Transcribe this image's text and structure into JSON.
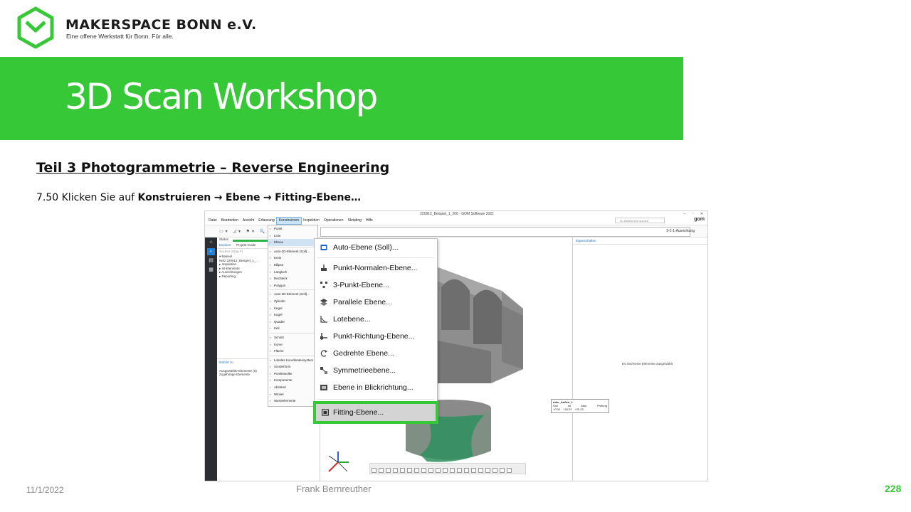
{
  "brand": {
    "name": "MAKERSPACE BONN e.V.",
    "tagline": "Eine offene Werkstatt für Bonn. Für alle.",
    "color": "#37c837"
  },
  "title": "3D Scan Workshop",
  "section_heading": "Teil 3  Photogrammetrie  – Reverse Engineering",
  "instruction": {
    "prefix": "7.50 Klicken Sie auf ",
    "step1": "Konstruieren",
    "step2": "Ebene",
    "step3": "Fitting-Ebene…",
    "arrow": "→"
  },
  "app": {
    "window_title": "220912_Beispiel_1_200 - GOM Software 2021",
    "window_controls": "– ▫ ✕",
    "menu": [
      "Datei",
      "Bearbeiten",
      "Ansicht",
      "Erfassung",
      "Konstruieren",
      "Inspektion",
      "Operationen",
      "Skripting",
      "Hilfe"
    ],
    "active_menu": "Konstruieren",
    "search_placeholder": "Im Zielelement suchen",
    "logo": "gom",
    "alignment": "3-2-1-Ausrichtung",
    "explorer": {
      "status_label": "Status",
      "tabs": [
        "Explorer",
        "Projekt-Guide"
      ],
      "search_placeholder": "Suchen (Strg+F)",
      "tree": [
        "▾ Basisel.",
        "   Netz 220912_Beispiel_1_...",
        " ▸ Inspektion",
        " ▸ Ist-Elemente",
        " ▸ Ausrichtungen",
        "▸ Reporting"
      ],
      "bottom_tab": "Gehört zu",
      "bottom_items": [
        "Ausgewählte Elemente (0)",
        "Zugehörige Elemente"
      ]
    },
    "right_panel": {
      "tab": "Eigenschaften",
      "empty_message": "Es sind keine Elemente ausgewählt."
    },
    "konstruieren_menu": [
      "Punkt",
      "Linie",
      "Ebene",
      "Auto-2D-Element (Soll)...",
      "Kreis",
      "Ellipse",
      "Langloch",
      "Rechteck",
      "Polygon",
      "Auto-3D-Element (Soll)...",
      "Zylinder",
      "Kegel",
      "Kugel",
      "Quader",
      "Keil",
      "Schnitt",
      "Kurve",
      "Fläche",
      "Lokales Koordinatensystem",
      "Sonderform",
      "Punktewolke",
      "Komponente",
      "Abstand",
      "Winkel",
      "Werteelemente"
    ],
    "konstruieren_selected": "Ebene",
    "ebene_submenu": [
      "Auto-Ebene (Soll)...",
      "Punkt-Normalen-Ebene...",
      "3-Punkt-Ebene...",
      "Parallele Ebene...",
      "Lotebene...",
      "Punkt-Richtung-Ebene...",
      "Gedrehte Ebene...",
      "Symmetrieebene...",
      "Ebene in Blickrichtung...",
      "Fitting-Ebene..."
    ],
    "ebene_highlight": "Fitting-Ebene...",
    "table": {
      "title": "nder_Außen_1",
      "headers": [
        "Soll",
        "Ist",
        "Abw.",
        "Prüfung"
      ],
      "values": [
        "+0.00",
        "+20.22",
        "+20.22",
        ""
      ]
    }
  },
  "footer": {
    "date": "11/1/2022",
    "author": "Frank Bernreuther",
    "page": "228"
  }
}
